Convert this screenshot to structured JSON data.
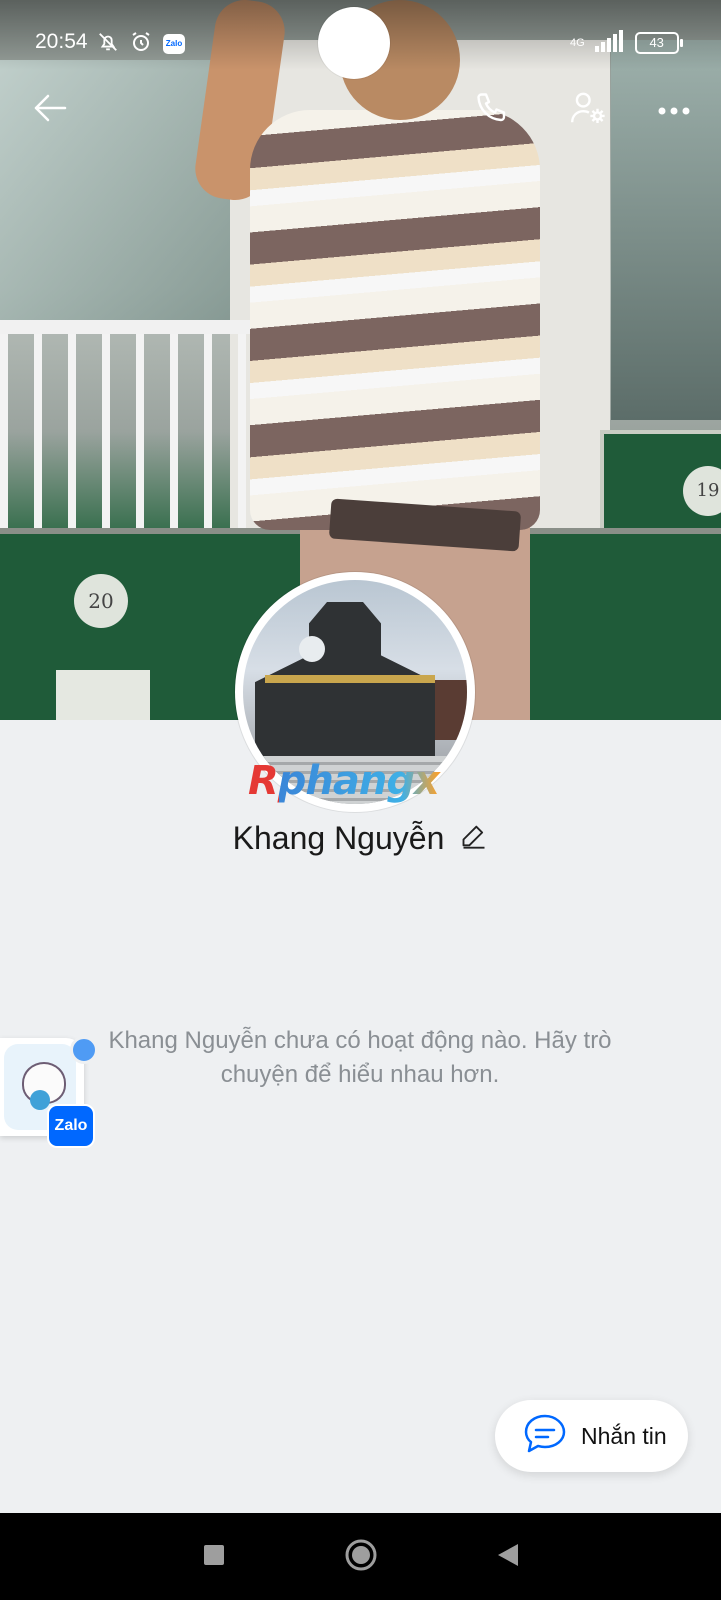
{
  "status_bar": {
    "time": "20:54",
    "zalo_badge": "Zalo",
    "network": "4G",
    "battery": "43"
  },
  "profile": {
    "name": "Khang Nguyễn",
    "empty_activity_text": "Khang Nguyễn chưa có hoạt động nào. Hãy trò chuyện để hiểu nhau hơn."
  },
  "watermark": "Rphangx",
  "cover_signs": {
    "sign_left": "20",
    "sign_right": "19"
  },
  "floating_bubble": {
    "badge": "Zalo"
  },
  "message_button": {
    "label": "Nhắn tin"
  },
  "icons": {
    "back": "arrow-left-icon",
    "call": "phone-icon",
    "profile_settings": "user-gear-icon",
    "more": "more-horizontal-icon",
    "edit": "pencil-icon",
    "chat": "chat-bubble-icon"
  },
  "colors": {
    "accent": "#0068ff",
    "background": "#eef0f2",
    "text": "#1a1a1a",
    "muted_text": "#8a8f94"
  }
}
